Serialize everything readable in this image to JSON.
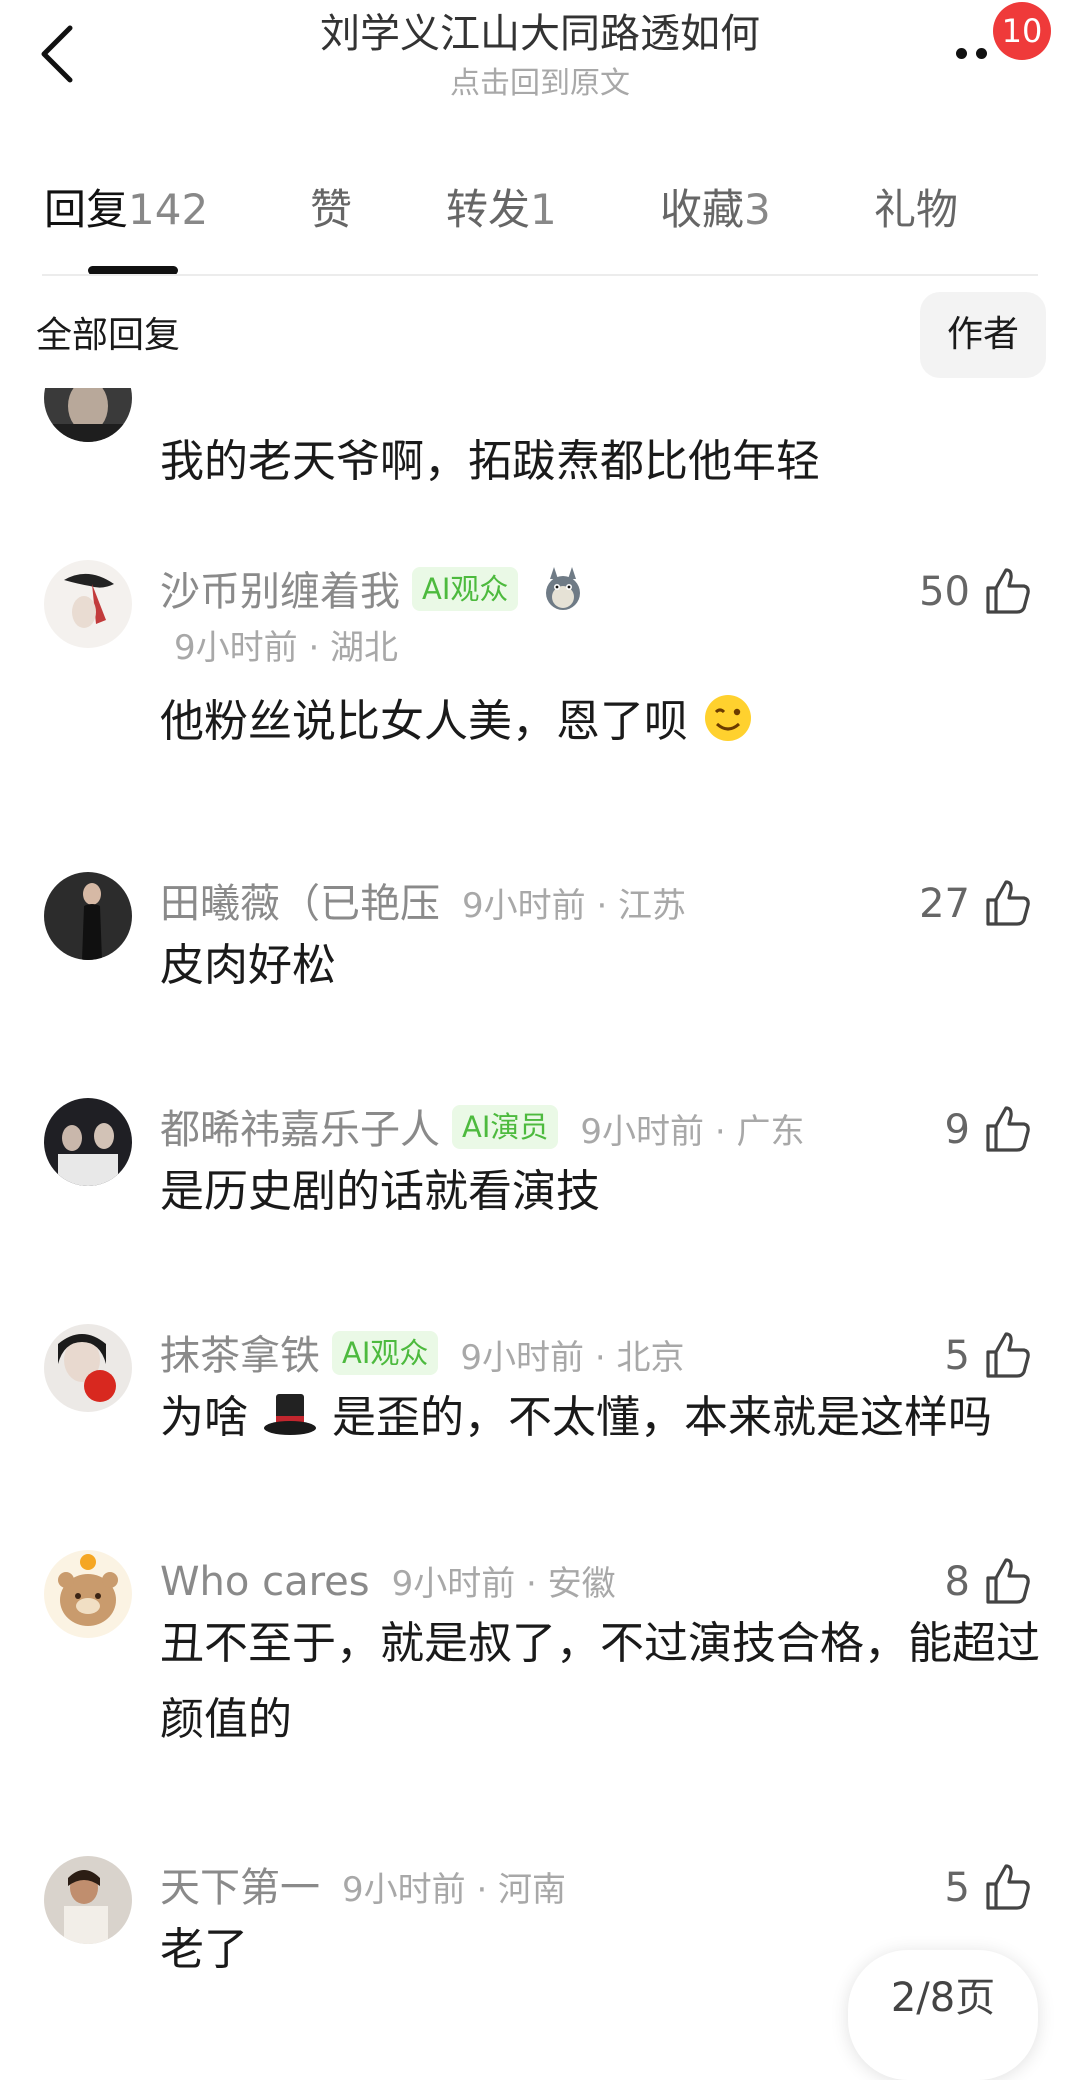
{
  "header": {
    "title": "刘学义江山大同路透如何",
    "subtitle": "点击回到原文",
    "notification_count": "10",
    "back_icon": "chevron-left-icon",
    "more_icon": "more-dots-icon"
  },
  "tabs": [
    {
      "label": "回复",
      "count": "142",
      "active": true
    },
    {
      "label": "赞",
      "count": ""
    },
    {
      "label": "转发",
      "count": "1"
    },
    {
      "label": "收藏",
      "count": "3"
    },
    {
      "label": "礼物",
      "count": ""
    }
  ],
  "filter": {
    "label": "全部回复",
    "author_button": "作者"
  },
  "comments": [
    {
      "user": "",
      "tag": "",
      "meta": "",
      "likes": "",
      "text": "我的老天爷啊，拓跋焘都比他年轻"
    },
    {
      "user": "沙币别缠着我",
      "tag": "AI观众",
      "meta": "9小时前 · 湖北",
      "likes": "50",
      "text": "他粉丝说比女人美，恩了呗",
      "badge_icon": "totoro-icon",
      "emoji": "wink-emoji-icon"
    },
    {
      "user": "田曦薇（已艳压",
      "tag": "",
      "meta": "9小时前 · 江苏",
      "likes": "27",
      "text": "皮肉好松"
    },
    {
      "user": "都晞祎嘉乐子人",
      "tag": "AI演员",
      "meta": "9小时前 · 广东",
      "likes": "9",
      "text": "是历史剧的话就看演技"
    },
    {
      "user": "抹茶拿铁",
      "tag": "AI观众",
      "meta": "9小时前 · 北京",
      "likes": "5",
      "text_before": "为啥",
      "text_after": "是歪的，不太懂，本来就是这样吗",
      "emoji": "top-hat-emoji-icon"
    },
    {
      "user": "Who cares",
      "tag": "",
      "meta": "9小时前 · 安徽",
      "likes": "8",
      "text": "丑不至于，就是叔了，不过演技合格，能超过颜值的"
    },
    {
      "user": "天下第一",
      "tag": "",
      "meta": "9小时前 · 河南",
      "likes": "5",
      "text": "老了"
    }
  ],
  "pagination": {
    "label": "2/8页"
  }
}
